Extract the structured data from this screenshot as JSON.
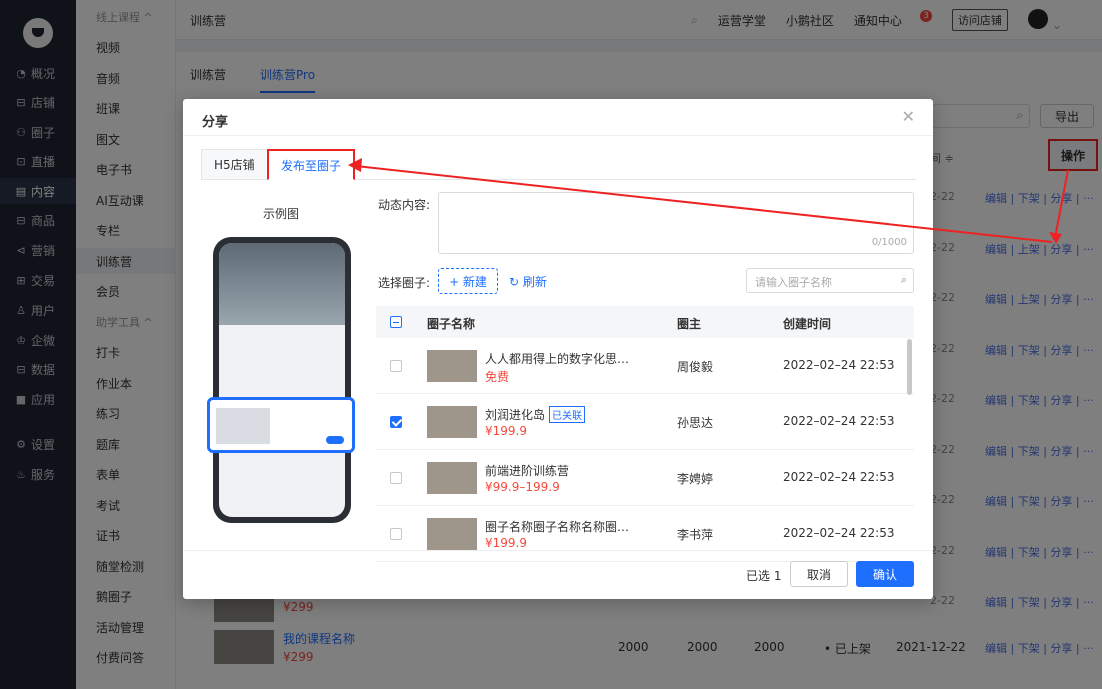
{
  "topbar": {
    "crumb": "训练营",
    "links": [
      "运营学堂",
      "小鹅社区",
      "通知中心"
    ],
    "notif_count": "3",
    "visit": "访问店铺"
  },
  "left_nav": {
    "items": [
      {
        "icon": "◔",
        "label": "概况"
      },
      {
        "icon": "⊟",
        "label": "店铺"
      },
      {
        "icon": "⚇",
        "label": "圈子"
      },
      {
        "icon": "⊡",
        "label": "直播"
      },
      {
        "icon": "▤",
        "label": "内容"
      },
      {
        "icon": "⊟",
        "label": "商品"
      },
      {
        "icon": "⊲",
        "label": "营销"
      },
      {
        "icon": "⊞",
        "label": "交易"
      },
      {
        "icon": "♙",
        "label": "用户"
      },
      {
        "icon": "♔",
        "label": "企微"
      },
      {
        "icon": "⊟",
        "label": "数据"
      },
      {
        "icon": "■",
        "label": "应用"
      },
      {
        "icon": "⚙",
        "label": "设置"
      },
      {
        "icon": "♨",
        "label": "服务"
      }
    ]
  },
  "sub_nav": {
    "items": [
      "线上课程 ^",
      "视频",
      "音频",
      "班课",
      "图文",
      "电子书",
      "AI互动课",
      "专栏",
      "训练营",
      "会员",
      "助学工具 ^",
      "打卡",
      "作业本",
      "练习",
      "题库",
      "表单",
      "考试",
      "证书",
      "随堂检测",
      "鹅圈子",
      "活动管理",
      "付费问答"
    ]
  },
  "page_tabs": [
    "训练营",
    "训练营Pro"
  ],
  "toolbar": {
    "export": "导出",
    "op_header": "操作",
    "date_header": "间 ≑"
  },
  "right_rows": [
    {
      "date": "2-22",
      "ops": "编辑 | 下架 | 分享 | ···"
    },
    {
      "date": "2-22",
      "ops": "编辑 | 上架 | 分享 | ···"
    },
    {
      "date": "2-22",
      "ops": "编辑 | 上架 | 分享 | ···"
    },
    {
      "date": "2-22",
      "ops": "编辑 | 下架 | 分享 | ···"
    },
    {
      "date": "2-22",
      "ops": "编辑 | 下架 | 分享 | ···"
    },
    {
      "date": "2-22",
      "ops": "编辑 | 下架 | 分享 | ···"
    },
    {
      "date": "2-22",
      "ops": "编辑 | 下架 | 分享 | ···"
    },
    {
      "date": "2-22",
      "ops": "编辑 | 下架 | 分享 | ···"
    },
    {
      "date": "2-22",
      "ops": "编辑 | 下架 | 分享 | ···"
    }
  ],
  "bottom_row": {
    "name": "我的课程名称",
    "price": "¥299",
    "a": "2000",
    "b": "2000",
    "c": "2000",
    "status": "• 已上架",
    "date": "2021-12-22",
    "ops": "编辑 | 下架 | 分享 | ···",
    "prev_price": "¥299"
  },
  "modal": {
    "title": "分享",
    "tabs": [
      "H5店铺",
      "发布至圈子"
    ],
    "demo_title": "示例图",
    "content_label": "动态内容:",
    "counter": "0/1000",
    "select_label": "选择圈子:",
    "new_btn": "+ 新建",
    "refresh": "刷新",
    "search_placeholder": "请输入圈子名称",
    "headers": {
      "name": "圈子名称",
      "owner": "圈主",
      "time": "创建时间"
    },
    "rows": [
      {
        "name": "人人都用得上的数字化思…",
        "price": "免费",
        "owner": "周俊毅",
        "time": "2022–02–24 22:53",
        "checked": false,
        "linked": ""
      },
      {
        "name": "刘润进化岛",
        "price": "¥199.9",
        "owner": "孙思达",
        "time": "2022–02–24 22:53",
        "checked": true,
        "linked": "已关联"
      },
      {
        "name": "前端进阶训练营",
        "price": "¥99.9–199.9",
        "owner": "李娉婷",
        "time": "2022–02–24 22:53",
        "checked": false,
        "linked": ""
      },
      {
        "name": "圈子名称圈子名称名称圈…",
        "price": "¥199.9",
        "owner": "李书萍",
        "time": "2022–02–24 22:53",
        "checked": false,
        "linked": ""
      }
    ],
    "selected": "已选 1",
    "cancel": "取消",
    "ok": "确认"
  },
  "colors": {
    "accent": "#1f6fff",
    "annot": "#e22"
  }
}
